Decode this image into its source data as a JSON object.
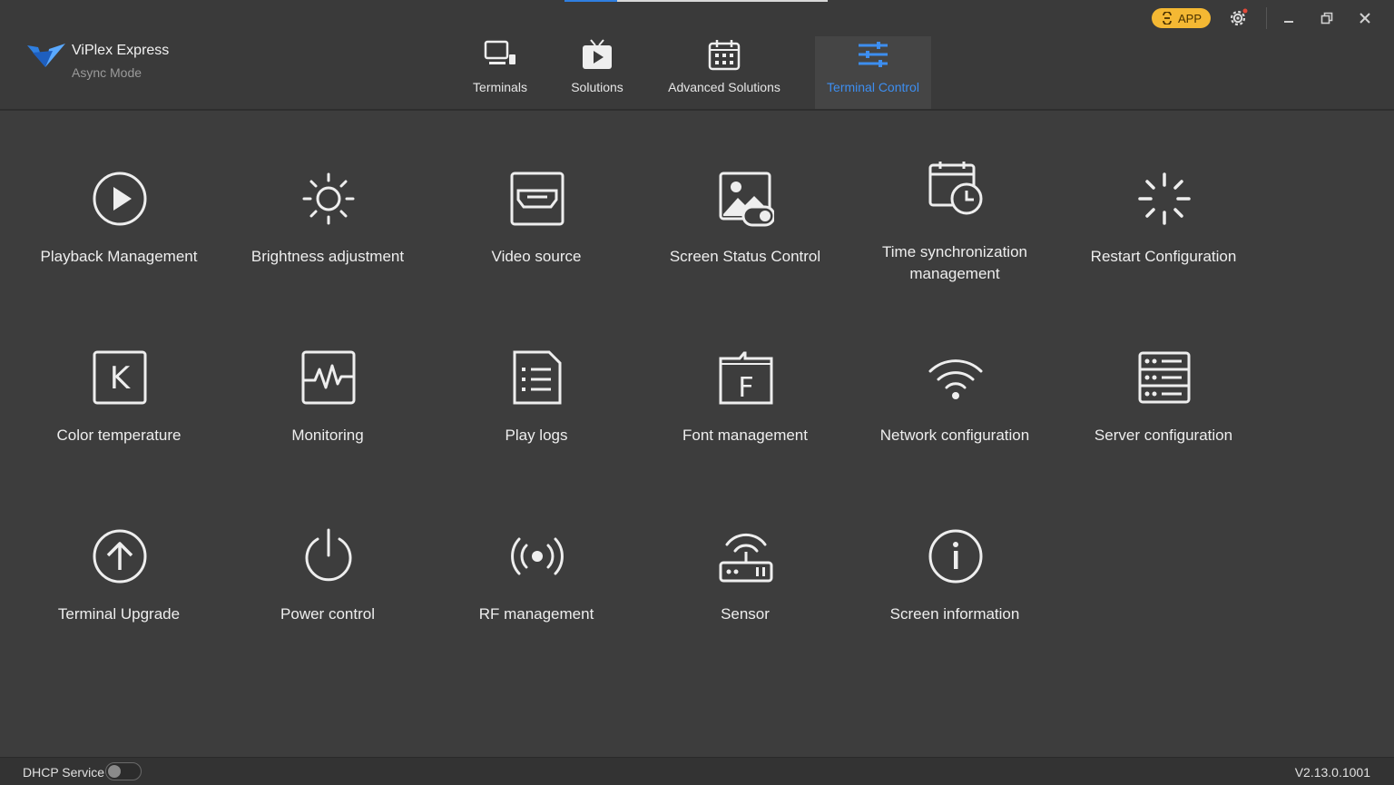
{
  "app": {
    "name": "ViPlex Express",
    "mode": "Async Mode"
  },
  "topbar": {
    "app_badge": "APP",
    "progress": 0.2
  },
  "nav": [
    {
      "label": "Terminals",
      "icon": "monitor-icon"
    },
    {
      "label": "Solutions",
      "icon": "play-tv-icon"
    },
    {
      "label": "Advanced Solutions",
      "icon": "calendar-icon"
    },
    {
      "label": "Terminal Control",
      "icon": "sliders-icon",
      "active": true
    }
  ],
  "tiles": [
    {
      "label": "Playback Management",
      "icon": "play-circle-icon"
    },
    {
      "label": "Brightness adjustment",
      "icon": "sun-icon"
    },
    {
      "label": "Video source",
      "icon": "hdmi-icon"
    },
    {
      "label": "Screen Status Control",
      "icon": "image-toggle-icon"
    },
    {
      "label": "Time synchronization management",
      "icon": "calendar-clock-icon"
    },
    {
      "label": "Restart Configuration",
      "icon": "spinner-icon"
    },
    {
      "label": "Color temperature",
      "icon": "k-box-icon"
    },
    {
      "label": "Monitoring",
      "icon": "pulse-icon"
    },
    {
      "label": "Play logs",
      "icon": "list-doc-icon"
    },
    {
      "label": "Font management",
      "icon": "font-folder-icon"
    },
    {
      "label": "Network configuration",
      "icon": "wifi-icon"
    },
    {
      "label": "Server configuration",
      "icon": "server-icon"
    },
    {
      "label": "Terminal Upgrade",
      "icon": "upload-circle-icon"
    },
    {
      "label": "Power control",
      "icon": "power-icon"
    },
    {
      "label": "RF management",
      "icon": "broadcast-icon"
    },
    {
      "label": "Sensor",
      "icon": "router-icon"
    },
    {
      "label": "Screen information",
      "icon": "info-circle-icon"
    }
  ],
  "footer": {
    "dhcp_label": "DHCP Service",
    "dhcp_enabled": false,
    "version": "V2.13.0.1001"
  },
  "colors": {
    "accent": "#3d8ef0",
    "badge": "#f4b833",
    "background": "#3d3d3d"
  }
}
